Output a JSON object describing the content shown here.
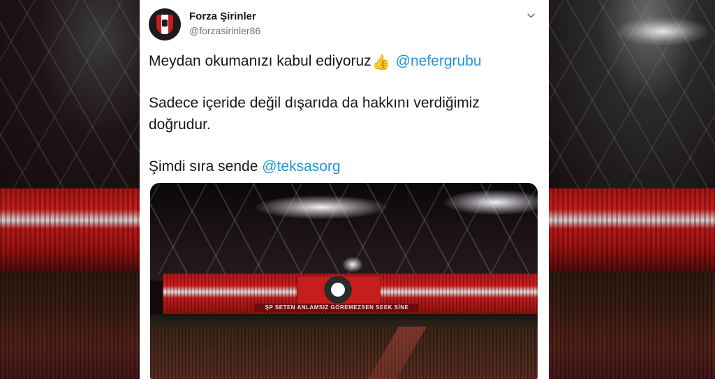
{
  "tweet": {
    "display_name": "Forza Şirinler",
    "handle": "@forzasirinler86",
    "lines": [
      {
        "text": "Meydan okumanızı kabul ediyoruz",
        "emoji": "👍",
        "mention": "@nefergrubu"
      },
      {
        "text": "Sadece içeride değil dışarıda da hakkını verdiğimiz"
      },
      {
        "text": "doğrudur."
      },
      {
        "text": "Şimdi sıra sende ",
        "mention": "@teksasorg"
      }
    ],
    "photo_banner_text": "ŞP SETEN ANLAMSIZ GÖREMEZSEN SEEK SİNE"
  },
  "icons": {
    "menu": "chevron-down-icon",
    "avatar": "team-crest-avatar"
  },
  "colors": {
    "mention": "#1b95e0",
    "text": "#14171a",
    "secondary": "#657786",
    "team_red": "#c61d1d"
  }
}
